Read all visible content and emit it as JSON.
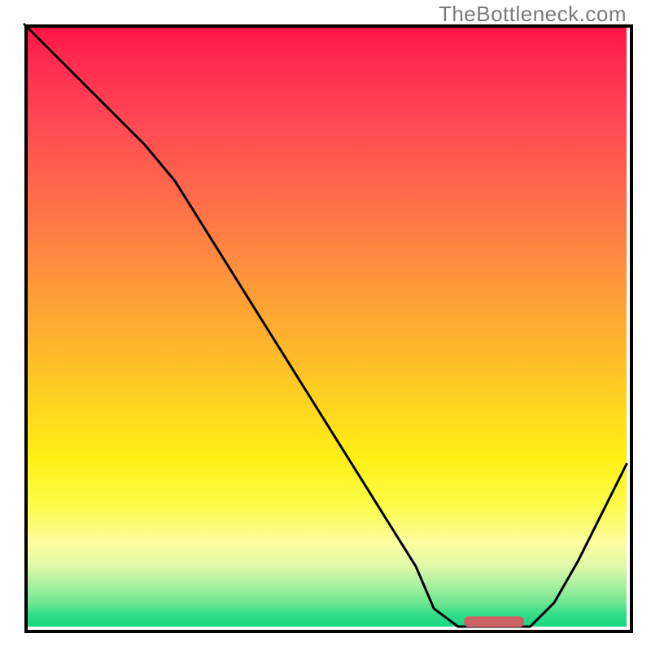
{
  "watermark": "TheBottleneck.com",
  "colors": {
    "curve": "#000000",
    "marker": "#cb6264",
    "border": "#000000"
  },
  "chart_data": {
    "type": "line",
    "title": "",
    "xlabel": "",
    "ylabel": "",
    "xlim": [
      0,
      100
    ],
    "ylim": [
      0,
      100
    ],
    "x": [
      0,
      5,
      10,
      15,
      20,
      25,
      30,
      35,
      40,
      45,
      50,
      55,
      60,
      65,
      68,
      72,
      76,
      80,
      84,
      88,
      92,
      96,
      100
    ],
    "values": [
      100,
      95,
      90,
      85,
      80,
      74,
      66,
      58,
      50,
      42,
      34,
      26,
      18,
      10,
      3,
      0,
      0,
      0,
      0,
      4,
      11,
      19,
      27
    ],
    "marker": {
      "x_start": 73,
      "x_end": 83,
      "y": 0.8,
      "thickness": 1.8
    },
    "gradient_stops": [
      {
        "pct": 0,
        "hex": "#ff1345"
      },
      {
        "pct": 15,
        "hex": "#ff4555"
      },
      {
        "pct": 40,
        "hex": "#ff8e3e"
      },
      {
        "pct": 63,
        "hex": "#ffd41f"
      },
      {
        "pct": 80,
        "hex": "#fcfc4a"
      },
      {
        "pct": 93,
        "hex": "#aaf0a0"
      },
      {
        "pct": 100,
        "hex": "#18d683"
      }
    ]
  }
}
